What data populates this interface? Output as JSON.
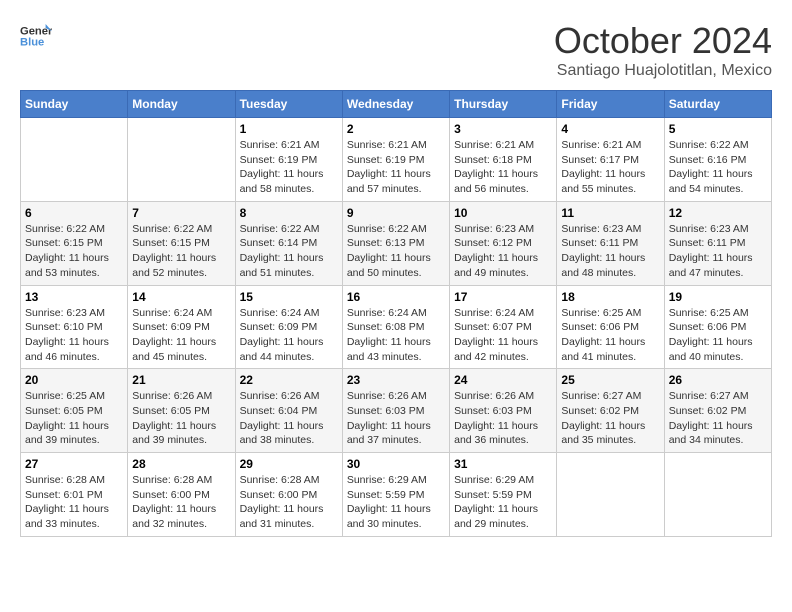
{
  "header": {
    "logo_line1": "General",
    "logo_line2": "Blue",
    "month": "October 2024",
    "location": "Santiago Huajolotitlan, Mexico"
  },
  "weekdays": [
    "Sunday",
    "Monday",
    "Tuesday",
    "Wednesday",
    "Thursday",
    "Friday",
    "Saturday"
  ],
  "weeks": [
    [
      {
        "day": "",
        "sunrise": "",
        "sunset": "",
        "daylight": ""
      },
      {
        "day": "",
        "sunrise": "",
        "sunset": "",
        "daylight": ""
      },
      {
        "day": "1",
        "sunrise": "Sunrise: 6:21 AM",
        "sunset": "Sunset: 6:19 PM",
        "daylight": "Daylight: 11 hours and 58 minutes."
      },
      {
        "day": "2",
        "sunrise": "Sunrise: 6:21 AM",
        "sunset": "Sunset: 6:19 PM",
        "daylight": "Daylight: 11 hours and 57 minutes."
      },
      {
        "day": "3",
        "sunrise": "Sunrise: 6:21 AM",
        "sunset": "Sunset: 6:18 PM",
        "daylight": "Daylight: 11 hours and 56 minutes."
      },
      {
        "day": "4",
        "sunrise": "Sunrise: 6:21 AM",
        "sunset": "Sunset: 6:17 PM",
        "daylight": "Daylight: 11 hours and 55 minutes."
      },
      {
        "day": "5",
        "sunrise": "Sunrise: 6:22 AM",
        "sunset": "Sunset: 6:16 PM",
        "daylight": "Daylight: 11 hours and 54 minutes."
      }
    ],
    [
      {
        "day": "6",
        "sunrise": "Sunrise: 6:22 AM",
        "sunset": "Sunset: 6:15 PM",
        "daylight": "Daylight: 11 hours and 53 minutes."
      },
      {
        "day": "7",
        "sunrise": "Sunrise: 6:22 AM",
        "sunset": "Sunset: 6:15 PM",
        "daylight": "Daylight: 11 hours and 52 minutes."
      },
      {
        "day": "8",
        "sunrise": "Sunrise: 6:22 AM",
        "sunset": "Sunset: 6:14 PM",
        "daylight": "Daylight: 11 hours and 51 minutes."
      },
      {
        "day": "9",
        "sunrise": "Sunrise: 6:22 AM",
        "sunset": "Sunset: 6:13 PM",
        "daylight": "Daylight: 11 hours and 50 minutes."
      },
      {
        "day": "10",
        "sunrise": "Sunrise: 6:23 AM",
        "sunset": "Sunset: 6:12 PM",
        "daylight": "Daylight: 11 hours and 49 minutes."
      },
      {
        "day": "11",
        "sunrise": "Sunrise: 6:23 AM",
        "sunset": "Sunset: 6:11 PM",
        "daylight": "Daylight: 11 hours and 48 minutes."
      },
      {
        "day": "12",
        "sunrise": "Sunrise: 6:23 AM",
        "sunset": "Sunset: 6:11 PM",
        "daylight": "Daylight: 11 hours and 47 minutes."
      }
    ],
    [
      {
        "day": "13",
        "sunrise": "Sunrise: 6:23 AM",
        "sunset": "Sunset: 6:10 PM",
        "daylight": "Daylight: 11 hours and 46 minutes."
      },
      {
        "day": "14",
        "sunrise": "Sunrise: 6:24 AM",
        "sunset": "Sunset: 6:09 PM",
        "daylight": "Daylight: 11 hours and 45 minutes."
      },
      {
        "day": "15",
        "sunrise": "Sunrise: 6:24 AM",
        "sunset": "Sunset: 6:09 PM",
        "daylight": "Daylight: 11 hours and 44 minutes."
      },
      {
        "day": "16",
        "sunrise": "Sunrise: 6:24 AM",
        "sunset": "Sunset: 6:08 PM",
        "daylight": "Daylight: 11 hours and 43 minutes."
      },
      {
        "day": "17",
        "sunrise": "Sunrise: 6:24 AM",
        "sunset": "Sunset: 6:07 PM",
        "daylight": "Daylight: 11 hours and 42 minutes."
      },
      {
        "day": "18",
        "sunrise": "Sunrise: 6:25 AM",
        "sunset": "Sunset: 6:06 PM",
        "daylight": "Daylight: 11 hours and 41 minutes."
      },
      {
        "day": "19",
        "sunrise": "Sunrise: 6:25 AM",
        "sunset": "Sunset: 6:06 PM",
        "daylight": "Daylight: 11 hours and 40 minutes."
      }
    ],
    [
      {
        "day": "20",
        "sunrise": "Sunrise: 6:25 AM",
        "sunset": "Sunset: 6:05 PM",
        "daylight": "Daylight: 11 hours and 39 minutes."
      },
      {
        "day": "21",
        "sunrise": "Sunrise: 6:26 AM",
        "sunset": "Sunset: 6:05 PM",
        "daylight": "Daylight: 11 hours and 39 minutes."
      },
      {
        "day": "22",
        "sunrise": "Sunrise: 6:26 AM",
        "sunset": "Sunset: 6:04 PM",
        "daylight": "Daylight: 11 hours and 38 minutes."
      },
      {
        "day": "23",
        "sunrise": "Sunrise: 6:26 AM",
        "sunset": "Sunset: 6:03 PM",
        "daylight": "Daylight: 11 hours and 37 minutes."
      },
      {
        "day": "24",
        "sunrise": "Sunrise: 6:26 AM",
        "sunset": "Sunset: 6:03 PM",
        "daylight": "Daylight: 11 hours and 36 minutes."
      },
      {
        "day": "25",
        "sunrise": "Sunrise: 6:27 AM",
        "sunset": "Sunset: 6:02 PM",
        "daylight": "Daylight: 11 hours and 35 minutes."
      },
      {
        "day": "26",
        "sunrise": "Sunrise: 6:27 AM",
        "sunset": "Sunset: 6:02 PM",
        "daylight": "Daylight: 11 hours and 34 minutes."
      }
    ],
    [
      {
        "day": "27",
        "sunrise": "Sunrise: 6:28 AM",
        "sunset": "Sunset: 6:01 PM",
        "daylight": "Daylight: 11 hours and 33 minutes."
      },
      {
        "day": "28",
        "sunrise": "Sunrise: 6:28 AM",
        "sunset": "Sunset: 6:00 PM",
        "daylight": "Daylight: 11 hours and 32 minutes."
      },
      {
        "day": "29",
        "sunrise": "Sunrise: 6:28 AM",
        "sunset": "Sunset: 6:00 PM",
        "daylight": "Daylight: 11 hours and 31 minutes."
      },
      {
        "day": "30",
        "sunrise": "Sunrise: 6:29 AM",
        "sunset": "Sunset: 5:59 PM",
        "daylight": "Daylight: 11 hours and 30 minutes."
      },
      {
        "day": "31",
        "sunrise": "Sunrise: 6:29 AM",
        "sunset": "Sunset: 5:59 PM",
        "daylight": "Daylight: 11 hours and 29 minutes."
      },
      {
        "day": "",
        "sunrise": "",
        "sunset": "",
        "daylight": ""
      },
      {
        "day": "",
        "sunrise": "",
        "sunset": "",
        "daylight": ""
      }
    ]
  ]
}
